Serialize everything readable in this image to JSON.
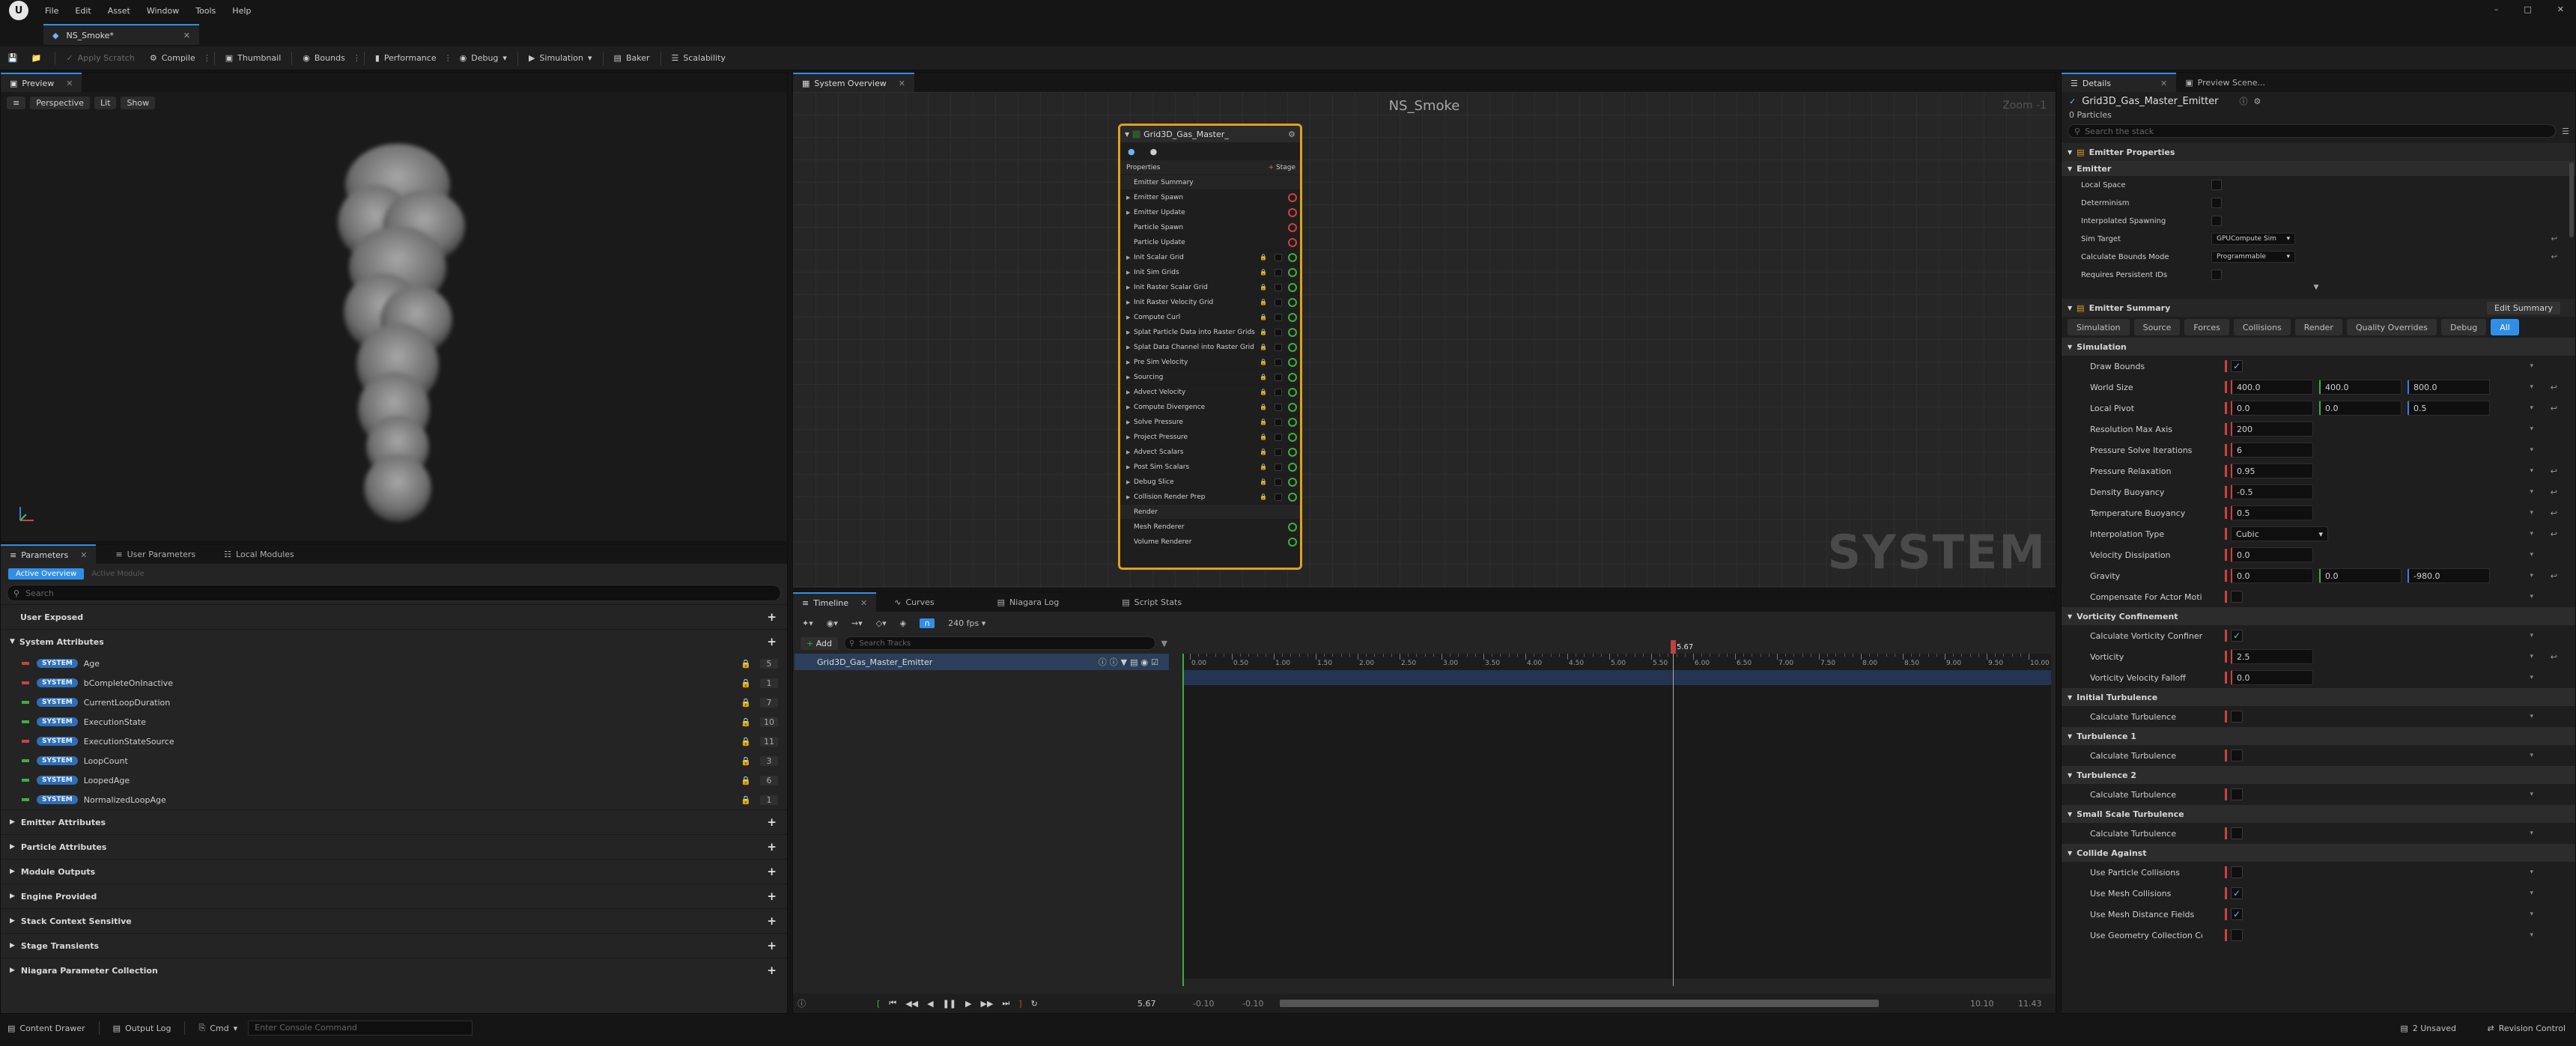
{
  "menu": {
    "items": [
      "File",
      "Edit",
      "Asset",
      "Window",
      "Tools",
      "Help"
    ]
  },
  "doc_tab": {
    "label": "NS_Smoke*"
  },
  "toolbar": {
    "apply_scratch": "Apply Scratch",
    "compile": "Compile",
    "thumbnail": "Thumbnail",
    "bounds": "Bounds",
    "performance": "Performance",
    "debug": "Debug",
    "simulation": "Simulation",
    "baker": "Baker",
    "scalability": "Scalability"
  },
  "preview": {
    "tab": "Preview",
    "perspective": "Perspective",
    "lit": "Lit",
    "show": "Show"
  },
  "params": {
    "tabs": [
      "Parameters",
      "User Parameters",
      "Local Modules"
    ],
    "toggle_active": "Active Overview",
    "toggle_inactive": "Active Module",
    "search_placeholder": "Search",
    "user_exposed": "User Exposed",
    "system_attributes": "System Attributes",
    "sys_tag": "SYSTEM",
    "attributes": [
      {
        "name": "Age",
        "count": "5"
      },
      {
        "name": "bCompleteOnInactive",
        "count": "1"
      },
      {
        "name": "CurrentLoopDuration",
        "count": "7"
      },
      {
        "name": "ExecutionState",
        "count": "10"
      },
      {
        "name": "ExecutionStateSource",
        "count": "11"
      },
      {
        "name": "LoopCount",
        "count": "3"
      },
      {
        "name": "LoopedAge",
        "count": "6"
      },
      {
        "name": "NormalizedLoopAge",
        "count": "1"
      }
    ],
    "sections": [
      "Emitter Attributes",
      "Particle Attributes",
      "Module Outputs",
      "Engine Provided",
      "Stack Context Sensitive",
      "Stage Transients",
      "Niagara Parameter Collection"
    ]
  },
  "overview": {
    "tab": "System Overview",
    "title": "NS_Smoke",
    "zoom": "Zoom -1",
    "watermark": "SYSTEM",
    "node_title": "Grid3D_Gas_Master_",
    "properties": "Properties",
    "stage": "Stage",
    "rows": [
      "Emitter Summary",
      "Emitter Spawn",
      "Emitter Update",
      "Particle Spawn",
      "Particle Update",
      "Init Scalar Grid",
      "Init Sim Grids",
      "Init Raster Scalar Grid",
      "Init Raster Velocity Grid",
      "Compute Curl",
      "Splat Particle Data into Raster Grids",
      "Splat Data Channel into Raster Grid",
      "Pre Sim Velocity",
      "Sourcing",
      "Advect Velocity",
      "Compute Divergence",
      "Solve Pressure",
      "Project Pressure",
      "Advect Scalars",
      "Post Sim Scalars",
      "Debug Slice",
      "Collision Render Prep",
      "Render",
      "Mesh Renderer",
      "Volume Renderer"
    ]
  },
  "timeline": {
    "tabs": [
      "Timeline",
      "Curves",
      "Niagara Log",
      "Script Stats"
    ],
    "fps": "240 fps",
    "add": "Add",
    "search_placeholder": "Search Tracks",
    "track": "Grid3D_Gas_Master_Emitter",
    "playhead": "5.67",
    "ticks": [
      "0.00",
      "0.50",
      "1.00",
      "1.50",
      "2.00",
      "2.50",
      "3.00",
      "3.50",
      "4.00",
      "4.50",
      "5.00",
      "5.50",
      "6.00",
      "6.50",
      "7.00",
      "7.50",
      "8.00",
      "8.50",
      "9.00",
      "9.50",
      "10.00"
    ],
    "current": "5.67",
    "start_a": "-0.10",
    "start_b": "-0.10",
    "end_a": "10.10",
    "end_b": "11.43"
  },
  "details": {
    "tabs": [
      "Details",
      "Preview Scene..."
    ],
    "emitter_name": "Grid3D_Gas_Master_Emitter",
    "particles": "0 Particles",
    "search_placeholder": "Search the stack",
    "emitter_properties": "Emitter Properties",
    "emitter": "Emitter",
    "props": [
      {
        "label": "Local Space"
      },
      {
        "label": "Determinism"
      },
      {
        "label": "Interpolated Spawning"
      },
      {
        "label": "Sim Target",
        "value": "GPUCompute Sim"
      },
      {
        "label": "Calculate Bounds Mode",
        "value": "Programmable"
      },
      {
        "label": "Requires Persistent IDs"
      }
    ],
    "emitter_summary": "Emitter Summary",
    "edit_summary": "Edit Summary",
    "filter_tabs": [
      "Simulation",
      "Source",
      "Forces",
      "Collisions",
      "Render",
      "Quality Overrides",
      "Debug",
      "All"
    ],
    "simulation": "Simulation",
    "sim_rows": [
      {
        "label": "Draw Bounds",
        "type": "check"
      },
      {
        "label": "World Size",
        "values": [
          "400.0",
          "400.0",
          "800.0"
        ]
      },
      {
        "label": "Local Pivot",
        "values": [
          "0.0",
          "0.0",
          "0.5"
        ]
      },
      {
        "label": "Resolution Max Axis",
        "values": [
          "200"
        ]
      },
      {
        "label": "Pressure Solve Iterations",
        "values": [
          "6"
        ]
      },
      {
        "label": "Pressure Relaxation",
        "values": [
          "0.95"
        ]
      },
      {
        "label": "Density Buoyancy",
        "values": [
          "-0.5"
        ]
      },
      {
        "label": "Temperature Buoyancy",
        "values": [
          "0.5"
        ]
      },
      {
        "label": "Interpolation Type",
        "select": "Cubic"
      },
      {
        "label": "Velocity Dissipation",
        "values": [
          "0.0"
        ]
      },
      {
        "label": "Gravity",
        "values": [
          "0.0",
          "0.0",
          "-980.0"
        ]
      },
      {
        "label": "Compensate For Actor Motion",
        "type": "empty"
      }
    ],
    "vorticity_confinement": "Vorticity Confinement",
    "vort_rows": [
      {
        "label": "Calculate Vorticity Confinement",
        "type": "check"
      },
      {
        "label": "Vorticity",
        "values": [
          "2.5"
        ]
      },
      {
        "label": "Vorticity Velocity Falloff",
        "values": [
          "0.0"
        ]
      }
    ],
    "initial_turbulence": "Initial Turbulence",
    "turbulence_1": "Turbulence 1",
    "turbulence_2": "Turbulence 2",
    "small_scale_turbulence": "Small Scale Turbulence",
    "calculate_turbulence": "Calculate Turbulence",
    "collide_against": "Collide Against",
    "collide_rows": [
      {
        "label": "Use Particle Collisions",
        "checked": false
      },
      {
        "label": "Use Mesh Collisions",
        "checked": true
      },
      {
        "label": "Use Mesh Distance Fields",
        "checked": true
      },
      {
        "label": "Use Geometry Collection Coll",
        "checked": false
      }
    ]
  },
  "statusbar": {
    "content_drawer": "Content Drawer",
    "output_log": "Output Log",
    "cmd": "Cmd",
    "console_placeholder": "Enter Console Command",
    "unsaved": "2 Unsaved",
    "revision": "Revision Control"
  }
}
